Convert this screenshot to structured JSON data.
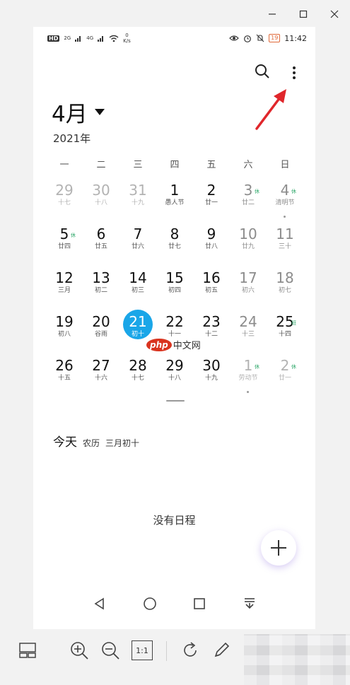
{
  "window": {
    "controls": [
      {
        "name": "minimize-icon"
      },
      {
        "name": "maximize-icon"
      },
      {
        "name": "close-icon"
      }
    ]
  },
  "status_bar": {
    "left": {
      "hd": "HD",
      "net1": "2G",
      "net2": "4G",
      "speed_value": "0",
      "speed_unit": "K/s"
    },
    "right": {
      "battery": "19",
      "time": "11:42"
    }
  },
  "header": {
    "month": "4月",
    "year": "2021年"
  },
  "weekdays": [
    "一",
    "二",
    "三",
    "四",
    "五",
    "六",
    "日"
  ],
  "calendar": [
    [
      {
        "d": "29",
        "l": "十七",
        "muted": true
      },
      {
        "d": "30",
        "l": "十八",
        "muted": true
      },
      {
        "d": "31",
        "l": "十九",
        "muted": true
      },
      {
        "d": "1",
        "l": "愚人节"
      },
      {
        "d": "2",
        "l": "廿一"
      },
      {
        "d": "3",
        "l": "廿二",
        "badge": "休",
        "weekend": true
      },
      {
        "d": "4",
        "l": "清明节",
        "badge": "休",
        "weekend": true,
        "dot": true
      }
    ],
    [
      {
        "d": "5",
        "l": "廿四",
        "badge": "休"
      },
      {
        "d": "6",
        "l": "廿五"
      },
      {
        "d": "7",
        "l": "廿六"
      },
      {
        "d": "8",
        "l": "廿七"
      },
      {
        "d": "9",
        "l": "廿八"
      },
      {
        "d": "10",
        "l": "廿九",
        "weekend": true
      },
      {
        "d": "11",
        "l": "三十",
        "weekend": true
      }
    ],
    [
      {
        "d": "12",
        "l": "三月"
      },
      {
        "d": "13",
        "l": "初二"
      },
      {
        "d": "14",
        "l": "初三"
      },
      {
        "d": "15",
        "l": "初四"
      },
      {
        "d": "16",
        "l": "初五"
      },
      {
        "d": "17",
        "l": "初六",
        "weekend": true
      },
      {
        "d": "18",
        "l": "初七",
        "weekend": true
      }
    ],
    [
      {
        "d": "19",
        "l": "初八"
      },
      {
        "d": "20",
        "l": "谷雨"
      },
      {
        "d": "21",
        "l": "初十",
        "today": true
      },
      {
        "d": "22",
        "l": "十一"
      },
      {
        "d": "23",
        "l": "十二"
      },
      {
        "d": "24",
        "l": "十三",
        "weekend": true
      },
      {
        "d": "25",
        "l": "十四",
        "badge": "班"
      }
    ],
    [
      {
        "d": "26",
        "l": "十五"
      },
      {
        "d": "27",
        "l": "十六"
      },
      {
        "d": "28",
        "l": "十七"
      },
      {
        "d": "29",
        "l": "十八"
      },
      {
        "d": "30",
        "l": "十九"
      },
      {
        "d": "1",
        "l": "劳动节",
        "badge": "休",
        "muted": true,
        "dot": true
      },
      {
        "d": "2",
        "l": "廿一",
        "badge": "休",
        "muted": true
      }
    ]
  ],
  "watermark": {
    "logo": "php",
    "text": "中文网"
  },
  "today_info": {
    "label": "今天",
    "lunar_prefix": "农历",
    "lunar_date": "三月初十"
  },
  "empty_state": "没有日程",
  "colors": {
    "accent": "#1aa6e8",
    "holiday_badge": "#2ea86a",
    "pointer_arrow": "#e0262b"
  },
  "nav": [
    {
      "name": "back-icon"
    },
    {
      "name": "home-icon"
    },
    {
      "name": "recents-icon"
    },
    {
      "name": "notification-down-icon"
    }
  ],
  "viewer_toolbar": {
    "actual_size_label": "1:1"
  }
}
